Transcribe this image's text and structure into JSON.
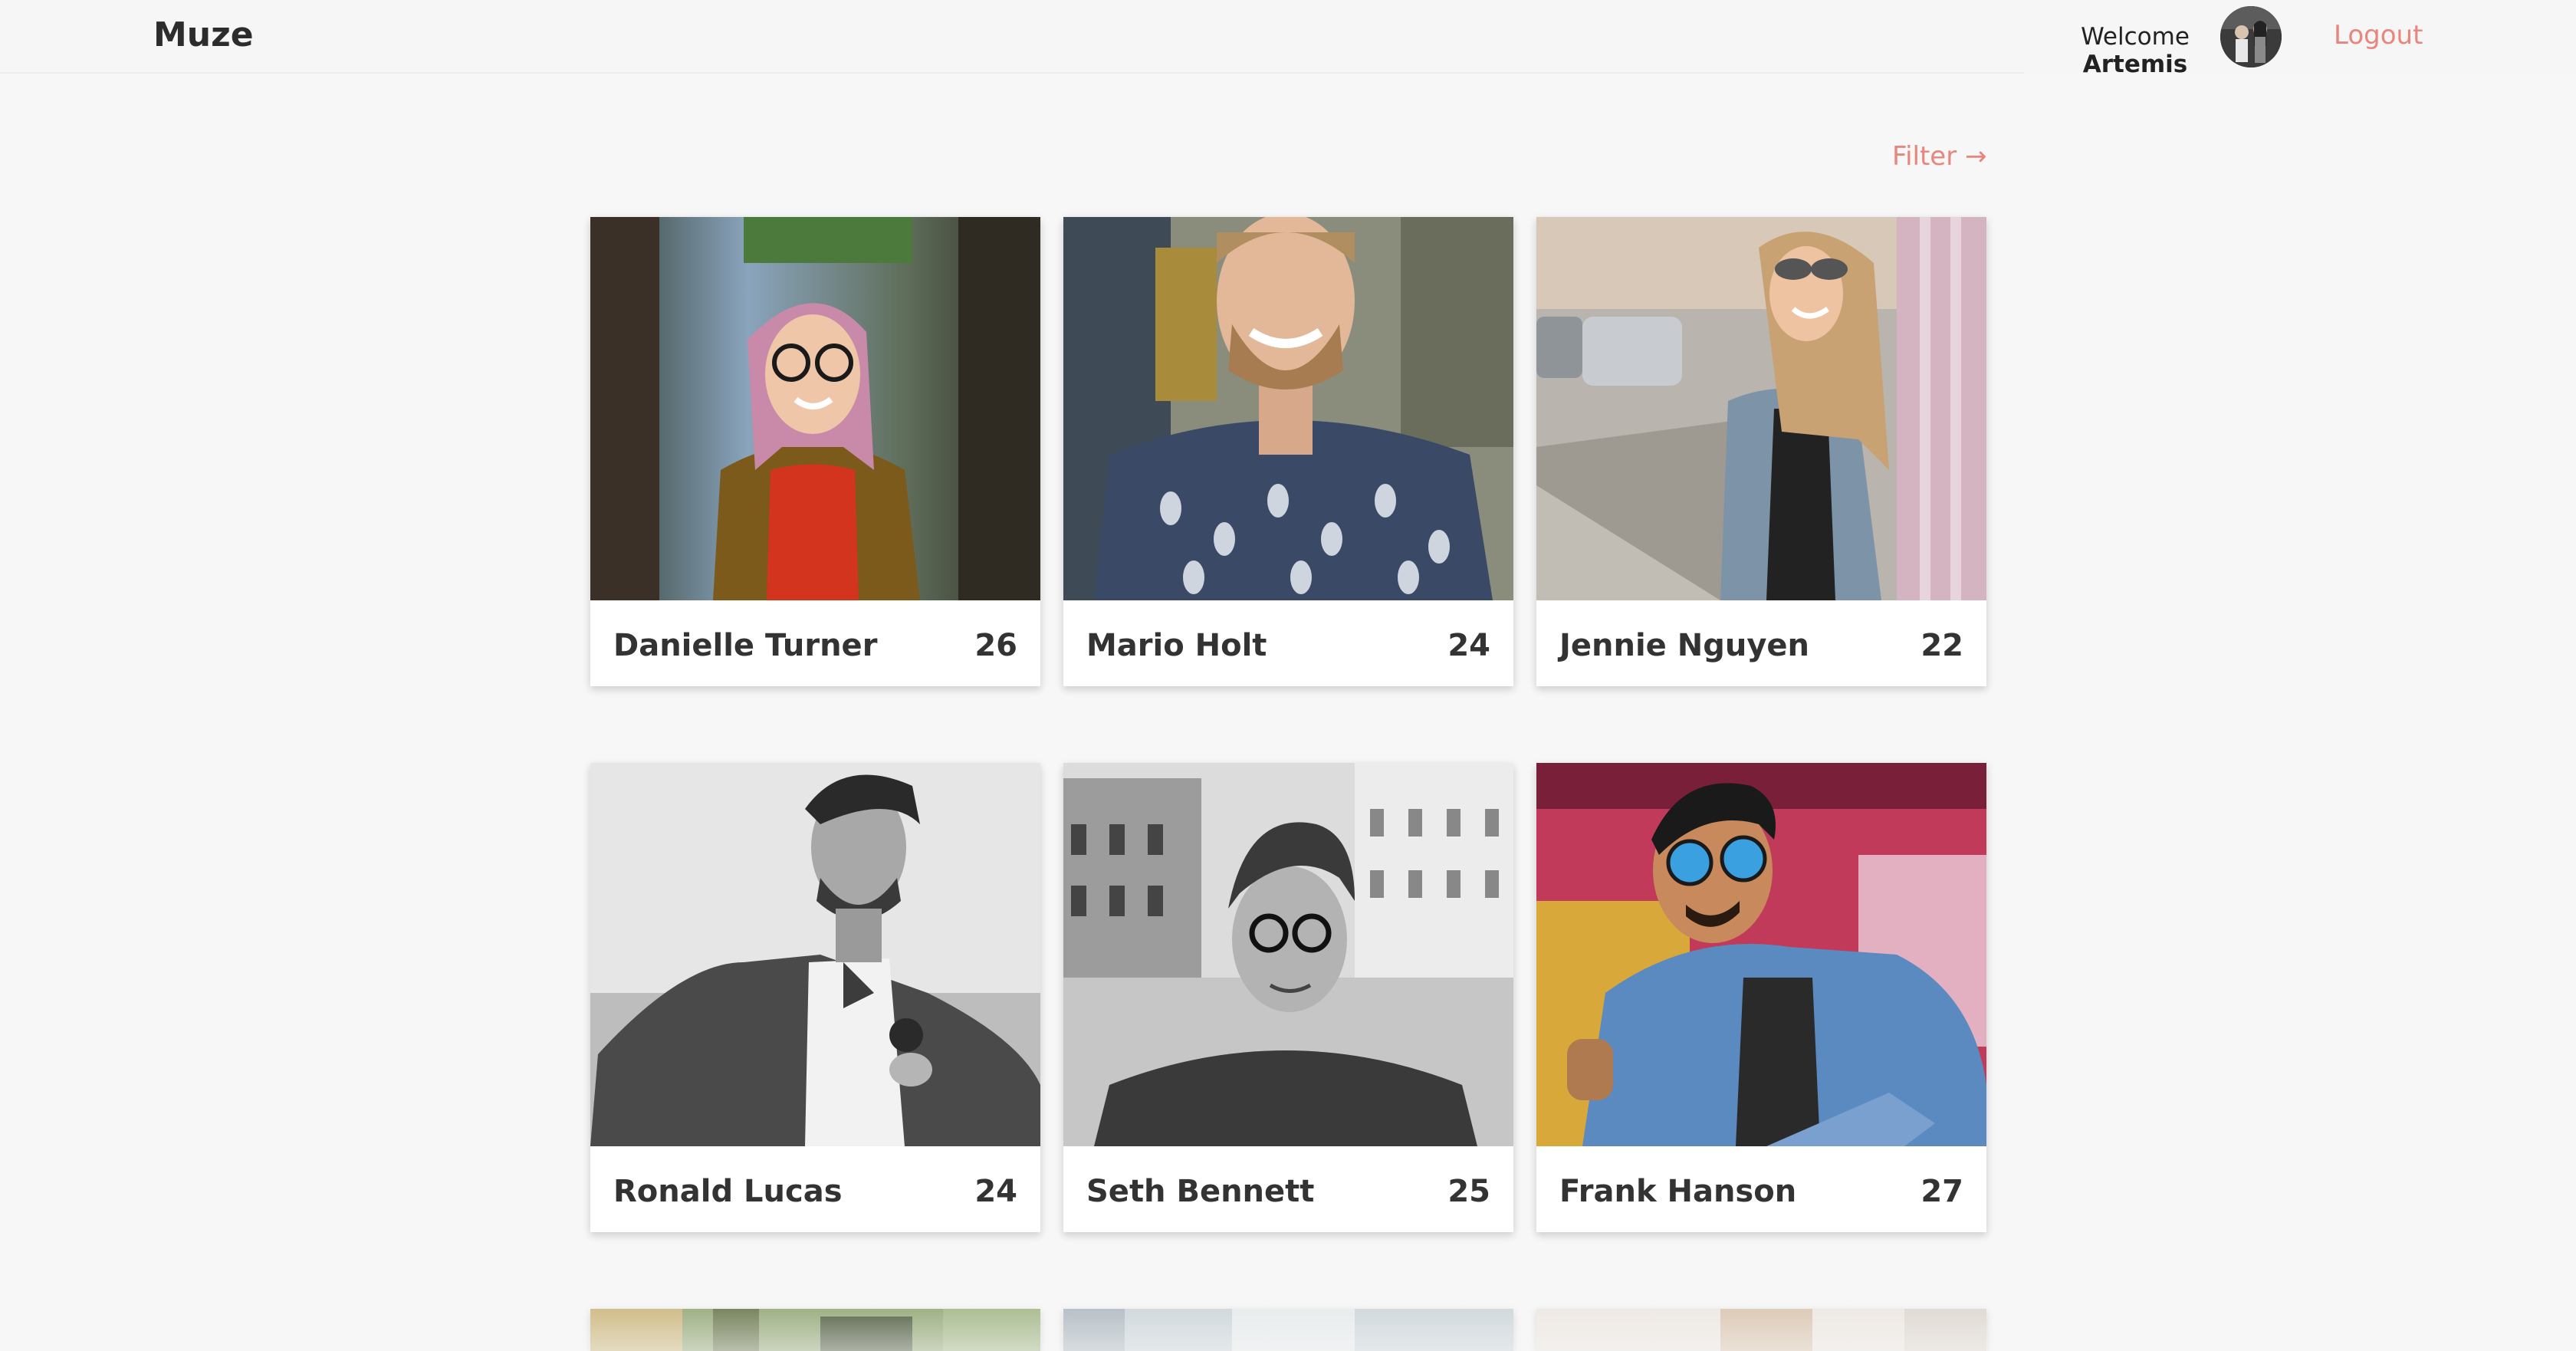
{
  "header": {
    "logo": "Muze",
    "welcome": "Welcome",
    "user_name": "Artemis",
    "logout": "Logout"
  },
  "filter_label": "Filter →",
  "profiles": [
    {
      "name": "Danielle Turner",
      "age": "26"
    },
    {
      "name": "Mario Holt",
      "age": "24"
    },
    {
      "name": "Jennie Nguyen",
      "age": "22"
    },
    {
      "name": "Ronald Lucas",
      "age": "24"
    },
    {
      "name": "Seth Bennett",
      "age": "25"
    },
    {
      "name": "Frank Hanson",
      "age": "27"
    }
  ],
  "colors": {
    "accent": "#e8857d",
    "background": "#f7f7f7"
  }
}
